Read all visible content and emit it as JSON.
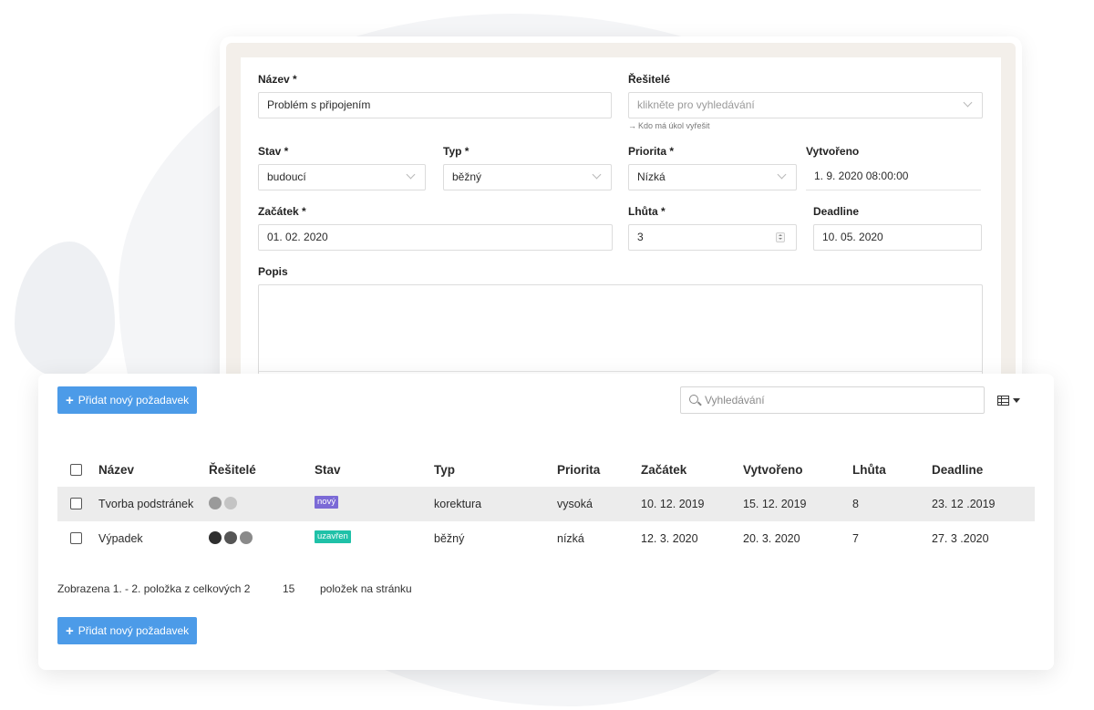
{
  "form": {
    "name": {
      "label": "Název *",
      "value": "Problém s připojením"
    },
    "assignees": {
      "label": "Řešitelé",
      "placeholder": "klikněte pro vyhledávání",
      "hint": "Kdo má úkol vyřešit"
    },
    "status": {
      "label": "Stav *",
      "value": "budoucí"
    },
    "type": {
      "label": "Typ *",
      "value": "běžný"
    },
    "priority": {
      "label": "Priorita *",
      "value": "Nízká"
    },
    "created": {
      "label": "Vytvořeno",
      "value": "1. 9. 2020 08:00:00"
    },
    "start": {
      "label": "Začátek *",
      "value": "01. 02. 2020"
    },
    "duration": {
      "label": "Lhůta *",
      "value": "3"
    },
    "deadline": {
      "label": "Deadline",
      "value": "10. 05. 2020"
    },
    "description": {
      "label": "Popis",
      "value": ""
    }
  },
  "list": {
    "add_button": "Přidat nový požadavek",
    "search_placeholder": "Vyhledávání",
    "columns": [
      "Název",
      "Řešitelé",
      "Stav",
      "Typ",
      "Priorita",
      "Začátek",
      "Vytvořeno",
      "Lhůta",
      "Deadline"
    ],
    "rows": [
      {
        "name": "Tvorba podstránek",
        "status": "nový",
        "status_color": "#7b6ad6",
        "type": "korektura",
        "priority": "vysoká",
        "start": "10. 12. 2019",
        "created": "15. 12. 2019",
        "duration": "8",
        "deadline": "23. 12 .2019"
      },
      {
        "name": "Výpadek",
        "status": "uzavřen",
        "status_color": "#1fc1a8",
        "type": "běžný",
        "priority": "nízká",
        "start": "12. 3. 2020",
        "created": "20. 3. 2020",
        "duration": "7",
        "deadline": "27. 3 .2020"
      }
    ],
    "summary": "Zobrazena 1. - 2. položka z celkových 2",
    "per_page": "15",
    "per_page_label": "položek na stránku"
  }
}
